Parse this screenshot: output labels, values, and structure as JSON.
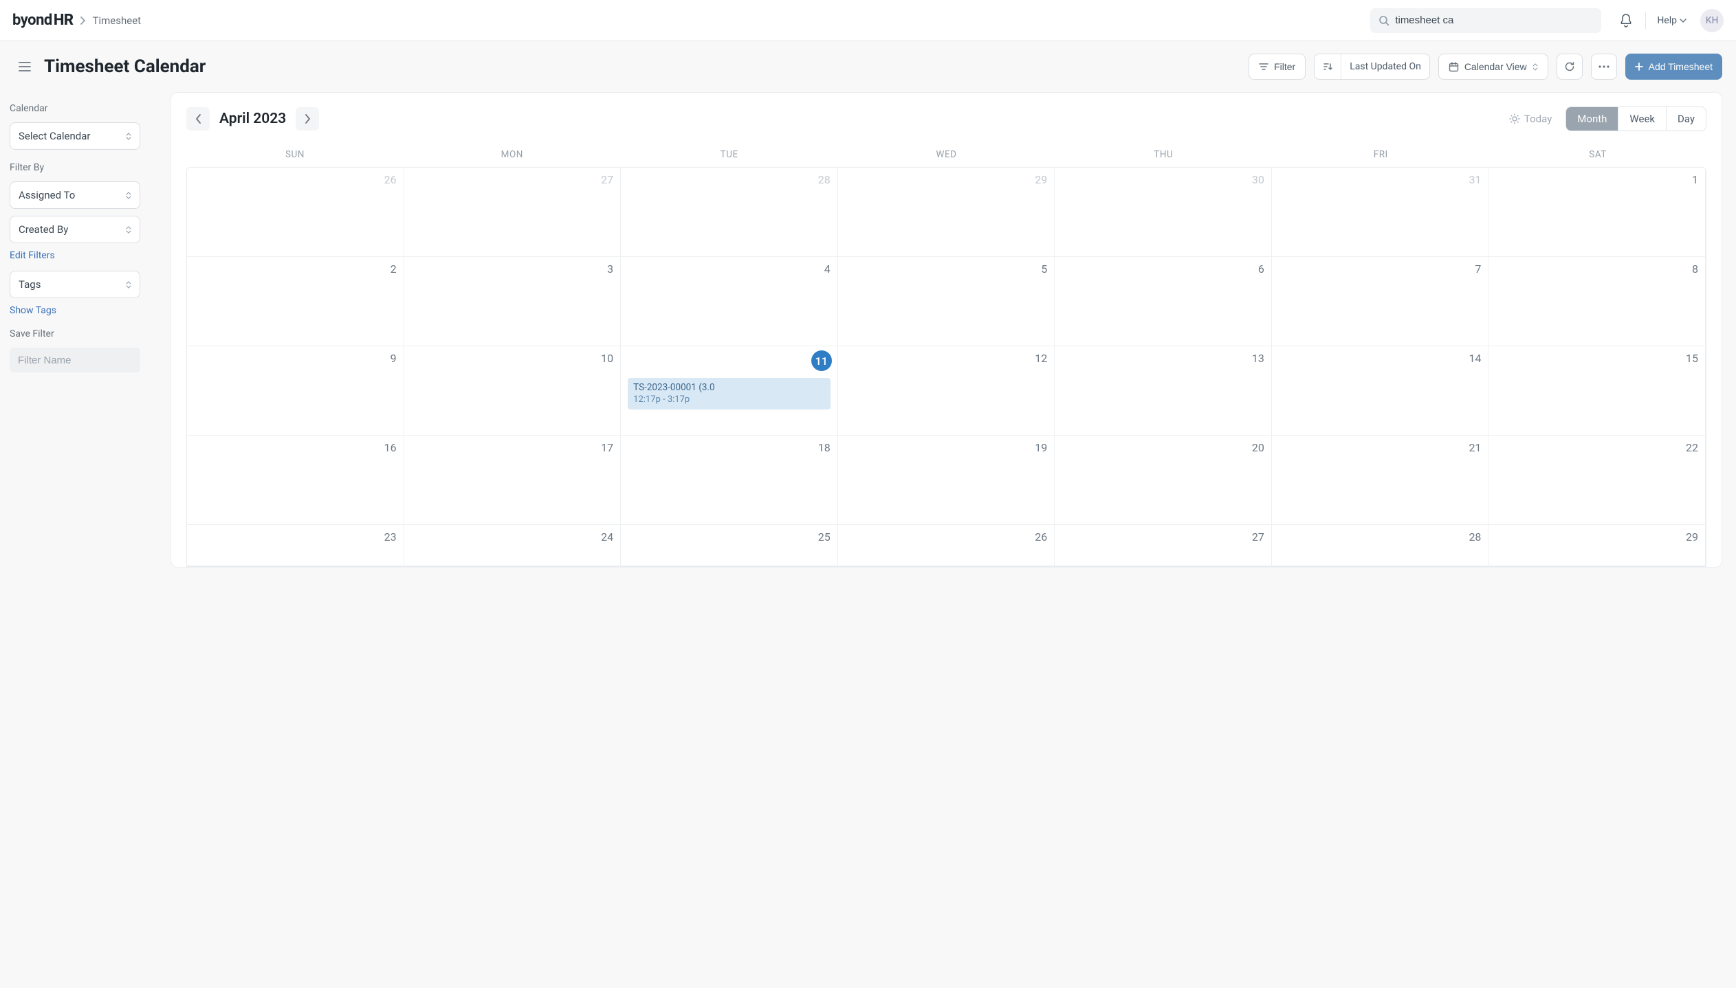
{
  "brand": {
    "byond": "byond",
    "hr": "HR"
  },
  "breadcrumb": "Timesheet",
  "search": {
    "value": "timesheet ca"
  },
  "help": {
    "label": "Help"
  },
  "user": {
    "initials": "KH"
  },
  "page": {
    "title": "Timesheet Calendar"
  },
  "toolbar": {
    "filter": "Filter",
    "last_updated": "Last Updated On",
    "calendar_view": "Calendar View",
    "add": "Add Timesheet"
  },
  "sidebar": {
    "calendar_label": "Calendar",
    "select_calendar": "Select Calendar",
    "filter_by_label": "Filter By",
    "assigned_to": "Assigned To",
    "created_by": "Created By",
    "edit_filters": "Edit Filters",
    "tags": "Tags",
    "show_tags": "Show Tags",
    "save_filter_label": "Save Filter",
    "filter_name_placeholder": "Filter Name"
  },
  "calendar": {
    "title": "April 2023",
    "today": "Today",
    "views": {
      "month": "Month",
      "week": "Week",
      "day": "Day"
    },
    "dow": [
      "SUN",
      "MON",
      "TUE",
      "WED",
      "THU",
      "FRI",
      "SAT"
    ],
    "weeks": [
      [
        {
          "n": "26",
          "out": true
        },
        {
          "n": "27",
          "out": true
        },
        {
          "n": "28",
          "out": true
        },
        {
          "n": "29",
          "out": true
        },
        {
          "n": "30",
          "out": true
        },
        {
          "n": "31",
          "out": true
        },
        {
          "n": "1"
        }
      ],
      [
        {
          "n": "2"
        },
        {
          "n": "3"
        },
        {
          "n": "4"
        },
        {
          "n": "5"
        },
        {
          "n": "6"
        },
        {
          "n": "7"
        },
        {
          "n": "8"
        }
      ],
      [
        {
          "n": "9"
        },
        {
          "n": "10"
        },
        {
          "n": "11",
          "today": true,
          "event": {
            "title": "TS-2023-00001 (3.0",
            "time": "12:17p - 3:17p"
          }
        },
        {
          "n": "12"
        },
        {
          "n": "13"
        },
        {
          "n": "14"
        },
        {
          "n": "15"
        }
      ],
      [
        {
          "n": "16"
        },
        {
          "n": "17"
        },
        {
          "n": "18"
        },
        {
          "n": "19"
        },
        {
          "n": "20"
        },
        {
          "n": "21"
        },
        {
          "n": "22"
        }
      ],
      [
        {
          "n": "23"
        },
        {
          "n": "24"
        },
        {
          "n": "25"
        },
        {
          "n": "26"
        },
        {
          "n": "27"
        },
        {
          "n": "28"
        },
        {
          "n": "29"
        }
      ]
    ]
  }
}
